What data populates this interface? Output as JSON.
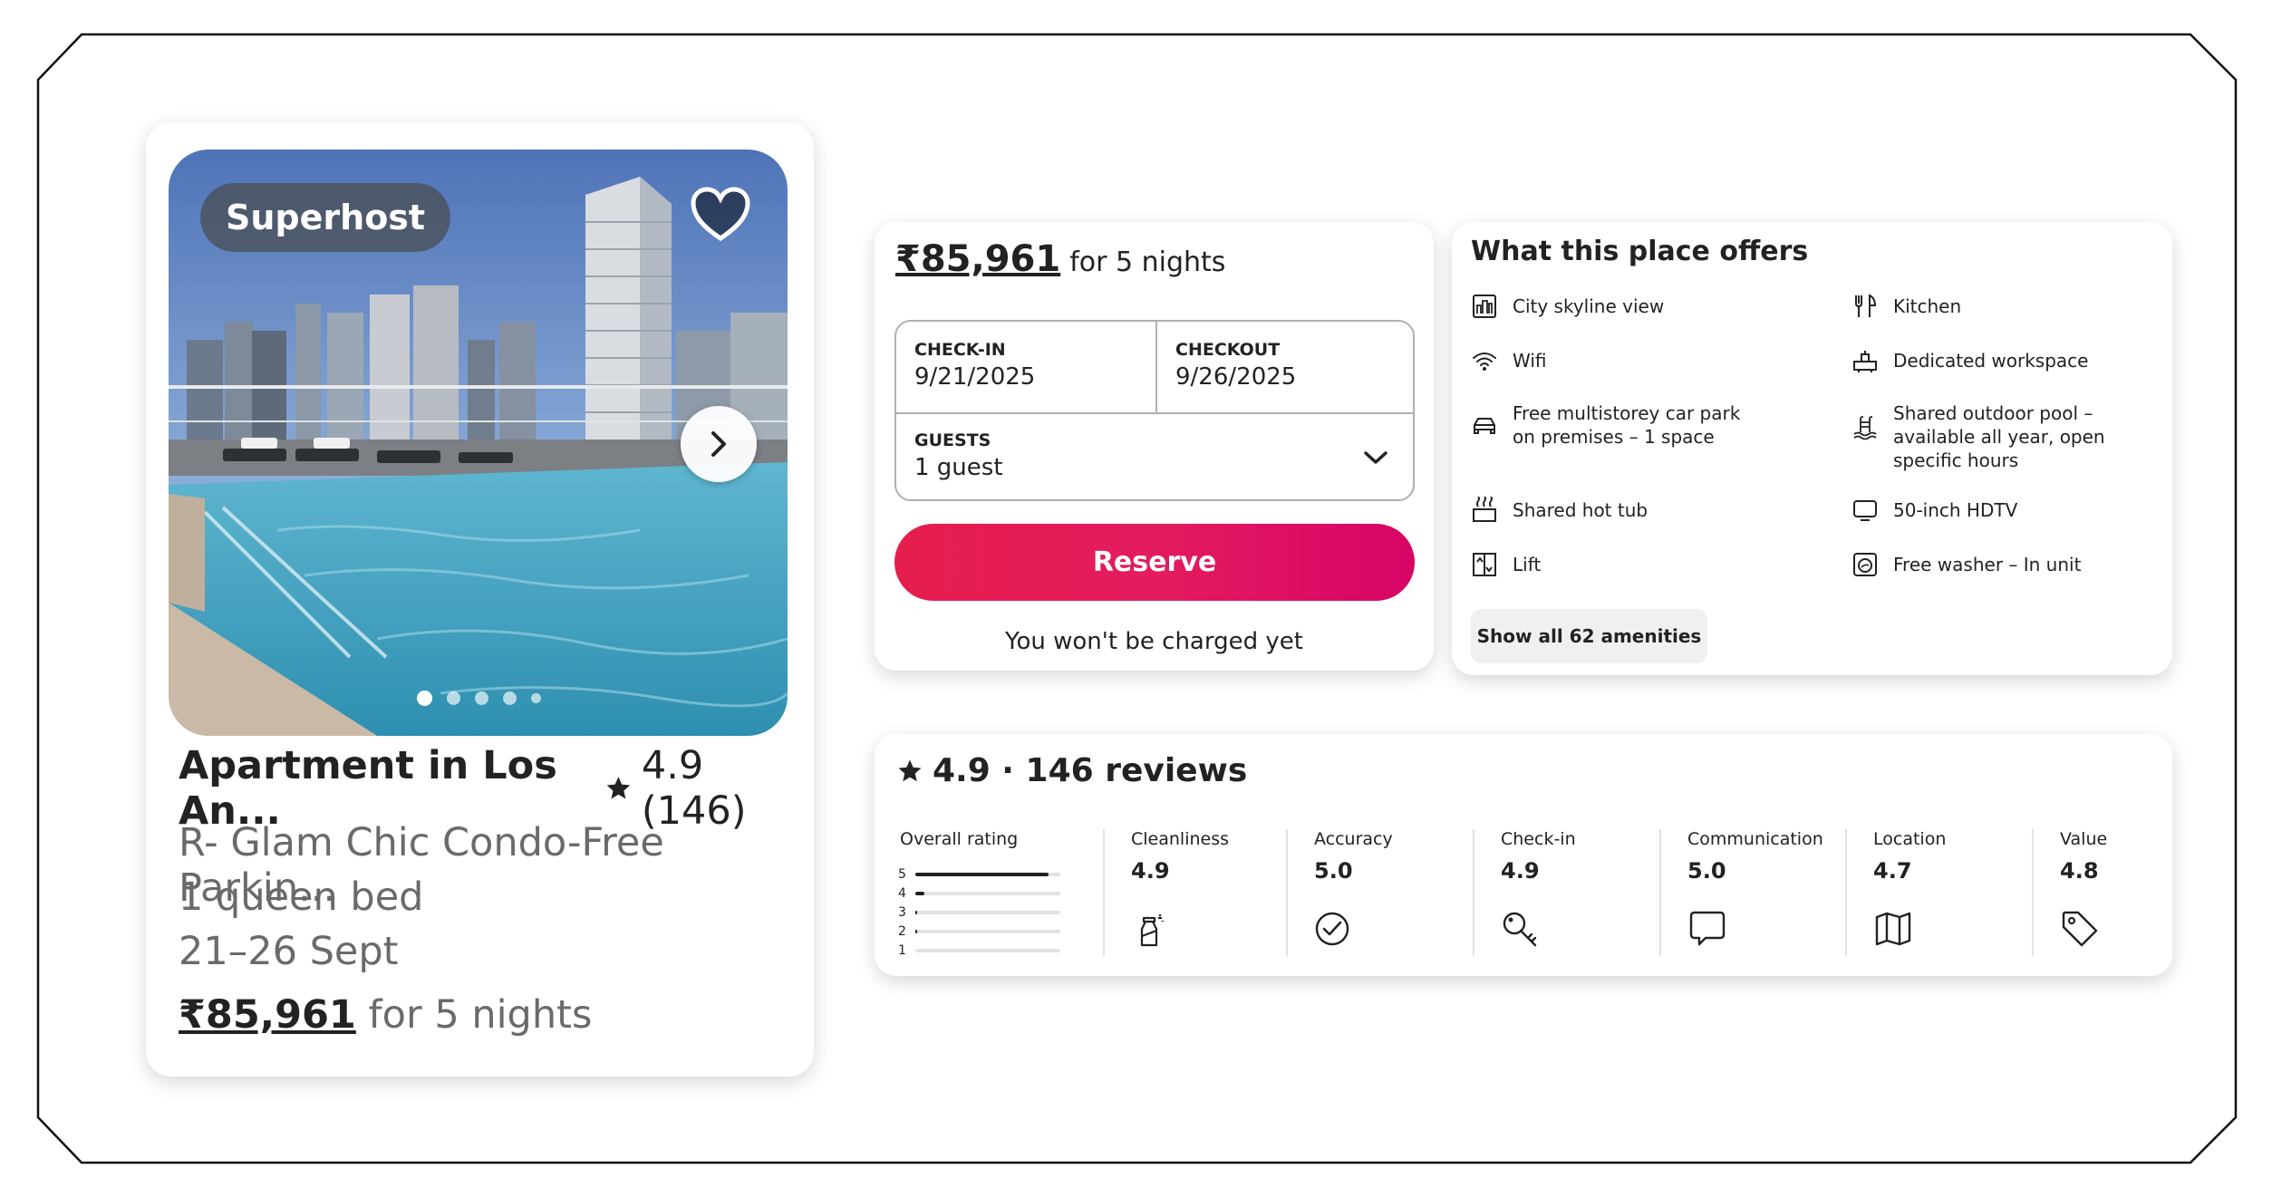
{
  "listing": {
    "badge": "Superhost",
    "title": "Apartment in Los An...",
    "rating": "4.9 (146)",
    "subtitle": "R- Glam Chic Condo-Free Parkin...",
    "beds": "1 queen bed",
    "dates": "21–26 Sept",
    "price_amount": "₹85,961",
    "price_suffix": "for 5 nights",
    "photo_count": 5,
    "active_photo": 1
  },
  "booking": {
    "price_amount": "₹85,961",
    "price_suffix": "for 5 nights",
    "checkin_label": "CHECK-IN",
    "checkin_value": "9/21/2025",
    "checkout_label": "CHECKOUT",
    "checkout_value": "9/26/2025",
    "guests_label": "GUESTS",
    "guests_value": "1 guest",
    "reserve_label": "Reserve",
    "note": "You won't be charged yet"
  },
  "amenities": {
    "title": "What this place offers",
    "items": [
      {
        "label": "City skyline view",
        "icon": "city-view-icon"
      },
      {
        "label": "Kitchen",
        "icon": "kitchen-icon"
      },
      {
        "label": "Wifi",
        "icon": "wifi-icon"
      },
      {
        "label": "Dedicated workspace",
        "icon": "workspace-icon"
      },
      {
        "label": "Free multistorey car park on premises – 1 space",
        "icon": "car-icon"
      },
      {
        "label": "Shared outdoor pool – available all year, open specific hours",
        "icon": "pool-icon"
      },
      {
        "label": "Shared hot tub",
        "icon": "hot-tub-icon"
      },
      {
        "label": "50-inch HDTV",
        "icon": "tv-icon"
      },
      {
        "label": "Lift",
        "icon": "lift-icon"
      },
      {
        "label": "Free washer – In unit",
        "icon": "washer-icon"
      }
    ],
    "show_all_label": "Show all 62 amenities"
  },
  "reviews": {
    "title": "4.9 · 146 reviews",
    "overall_label": "Overall rating",
    "distribution": [
      {
        "stars": "5",
        "fraction": 0.92
      },
      {
        "stars": "4",
        "fraction": 0.06
      },
      {
        "stars": "3",
        "fraction": 0.01
      },
      {
        "stars": "2",
        "fraction": 0.01
      },
      {
        "stars": "1",
        "fraction": 0.0
      }
    ],
    "categories": [
      {
        "label": "Cleanliness",
        "value": "4.9",
        "icon": "spray-bottle-icon"
      },
      {
        "label": "Accuracy",
        "value": "5.0",
        "icon": "check-circle-icon"
      },
      {
        "label": "Check-in",
        "value": "4.9",
        "icon": "key-icon"
      },
      {
        "label": "Communication",
        "value": "5.0",
        "icon": "chat-bubble-icon"
      },
      {
        "label": "Location",
        "value": "4.7",
        "icon": "map-icon"
      },
      {
        "label": "Value",
        "value": "4.8",
        "icon": "tag-icon"
      }
    ]
  },
  "colors": {
    "reserve_start": "#e61e4d",
    "reserve_end": "#d70466",
    "text": "#222222",
    "muted": "#6a6a6a"
  }
}
